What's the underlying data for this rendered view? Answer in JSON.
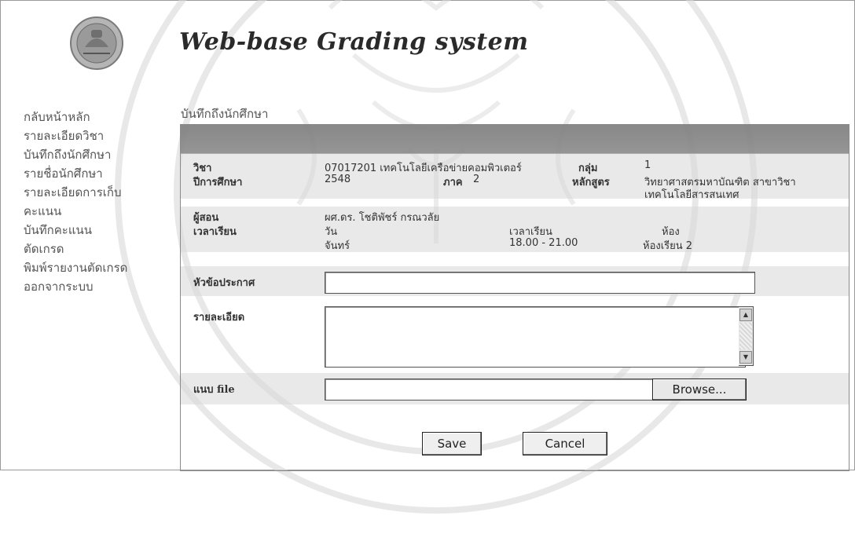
{
  "app": {
    "title": "Web-base Grading system"
  },
  "sidebar": {
    "items": [
      {
        "label": "กลับหน้าหลัก"
      },
      {
        "label": "รายละเอียดวิชา"
      },
      {
        "label": "บันทึกถึงนักศึกษา"
      },
      {
        "label": "รายชื่อนักศึกษา"
      },
      {
        "label": "รายละเอียดการเก็บ"
      },
      {
        "label": "คะแนน"
      },
      {
        "label": "บันทึกคะแนน"
      },
      {
        "label": "ตัดเกรด"
      },
      {
        "label": "พิมพ์รายงานตัดเกรด"
      },
      {
        "label": "ออกจากระบบ"
      }
    ]
  },
  "breadcrumb": "บันทึกถึงนักศึกษา",
  "course": {
    "subject_label": "วิชา",
    "subject_value": "07017201 เทคโนโลยีเครือข่ายคอมพิวเตอร์",
    "group_label": "กลุ่ม",
    "group_value": "1",
    "year_label": "ปีการศึกษา",
    "year_value": "2548",
    "term_label": "ภาค",
    "term_value": "2",
    "curriculum_label": "หลักสูตร",
    "curriculum_value_1": "วิทยาศาสตรมหาบัณฑิต สาขาวิชา",
    "curriculum_value_2": "เทคโนโลยีสารสนเทศ",
    "instructor_label": "ผู้สอน",
    "instructor_value": "ผศ.ดร. โชติพัชร์ กรณวลัย",
    "schedule_label": "เวลาเรียน",
    "day_header": "วัน",
    "time_header": "เวลาเรียน",
    "room_header": "ห้อง",
    "day_value": "จันทร์",
    "time_value": "18.00 - 21.00",
    "room_value": "ห้องเรียน 2"
  },
  "form": {
    "subject_label": "หัวข้อประกาศ",
    "subject_value": "",
    "detail_label": "รายละเอียด",
    "detail_value": "",
    "attach_label": "แนบ file",
    "browse_label": "Browse...",
    "save_label": "Save",
    "cancel_label": "Cancel"
  }
}
